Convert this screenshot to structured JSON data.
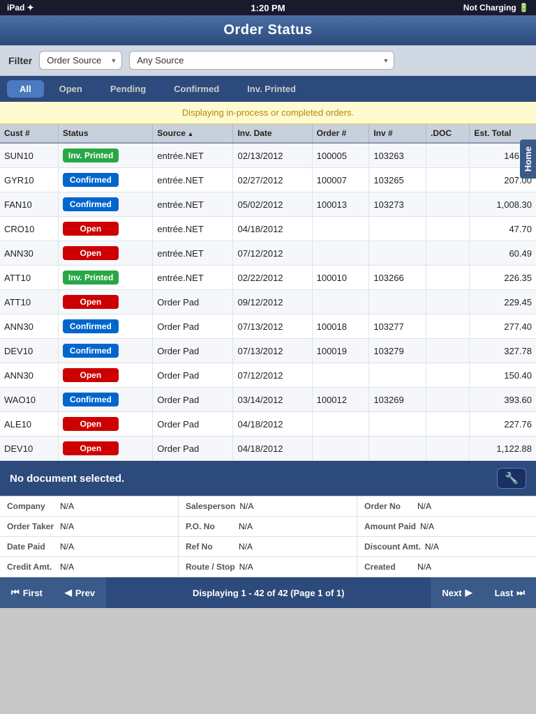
{
  "statusBar": {
    "left": "iPad ✦",
    "time": "1:20 PM",
    "right": "Not Charging 🔋"
  },
  "header": {
    "title": "Order Status"
  },
  "homeTab": "Home",
  "filter": {
    "label": "Filter",
    "sourceLabel": "Order Source",
    "sourceValue": "Any Source"
  },
  "tabs": [
    {
      "id": "all",
      "label": "All",
      "active": true
    },
    {
      "id": "open",
      "label": "Open",
      "active": false
    },
    {
      "id": "pending",
      "label": "Pending",
      "active": false
    },
    {
      "id": "confirmed",
      "label": "Confirmed",
      "active": false
    },
    {
      "id": "inv-printed",
      "label": "Inv. Printed",
      "active": false
    }
  ],
  "infoBanner": "Displaying in-process or completed orders.",
  "table": {
    "columns": [
      "Cust #",
      "Status",
      "Source",
      "Inv. Date",
      "Order #",
      "Inv #",
      ".DOC",
      "Est. Total"
    ],
    "rows": [
      {
        "cust": "SUN10",
        "status": "Inv. Printed",
        "statusType": "inv-printed",
        "source": "entrée.NET",
        "invDate": "02/13/2012",
        "order": "100005",
        "inv": "103263",
        "doc": "",
        "estTotal": "146.40"
      },
      {
        "cust": "GYR10",
        "status": "Confirmed",
        "statusType": "confirmed",
        "source": "entrée.NET",
        "invDate": "02/27/2012",
        "order": "100007",
        "inv": "103265",
        "doc": "",
        "estTotal": "207.00"
      },
      {
        "cust": "FAN10",
        "status": "Confirmed",
        "statusType": "confirmed",
        "source": "entrée.NET",
        "invDate": "05/02/2012",
        "order": "100013",
        "inv": "103273",
        "doc": "",
        "estTotal": "1,008.30"
      },
      {
        "cust": "CRO10",
        "status": "Open",
        "statusType": "open",
        "source": "entrée.NET",
        "invDate": "04/18/2012",
        "order": "",
        "inv": "",
        "doc": "",
        "estTotal": "47.70"
      },
      {
        "cust": "ANN30",
        "status": "Open",
        "statusType": "open",
        "source": "entrée.NET",
        "invDate": "07/12/2012",
        "order": "",
        "inv": "",
        "doc": "",
        "estTotal": "60.49"
      },
      {
        "cust": "ATT10",
        "status": "Inv. Printed",
        "statusType": "inv-printed",
        "source": "entrée.NET",
        "invDate": "02/22/2012",
        "order": "100010",
        "inv": "103266",
        "doc": "",
        "estTotal": "226.35"
      },
      {
        "cust": "ATT10",
        "status": "Open",
        "statusType": "open",
        "source": "Order Pad",
        "invDate": "09/12/2012",
        "order": "",
        "inv": "",
        "doc": "",
        "estTotal": "229.45"
      },
      {
        "cust": "ANN30",
        "status": "Confirmed",
        "statusType": "confirmed",
        "source": "Order Pad",
        "invDate": "07/13/2012",
        "order": "100018",
        "inv": "103277",
        "doc": "",
        "estTotal": "277.40"
      },
      {
        "cust": "DEV10",
        "status": "Confirmed",
        "statusType": "confirmed",
        "source": "Order Pad",
        "invDate": "07/13/2012",
        "order": "100019",
        "inv": "103279",
        "doc": "",
        "estTotal": "327.78"
      },
      {
        "cust": "ANN30",
        "status": "Open",
        "statusType": "open",
        "source": "Order Pad",
        "invDate": "07/12/2012",
        "order": "",
        "inv": "",
        "doc": "",
        "estTotal": "150.40"
      },
      {
        "cust": "WAO10",
        "status": "Confirmed",
        "statusType": "confirmed",
        "source": "Order Pad",
        "invDate": "03/14/2012",
        "order": "100012",
        "inv": "103269",
        "doc": "",
        "estTotal": "393.60"
      },
      {
        "cust": "ALE10",
        "status": "Open",
        "statusType": "open",
        "source": "Order Pad",
        "invDate": "04/18/2012",
        "order": "",
        "inv": "",
        "doc": "",
        "estTotal": "227.76"
      },
      {
        "cust": "DEV10",
        "status": "Open",
        "statusType": "open",
        "source": "Order Pad",
        "invDate": "04/18/2012",
        "order": "",
        "inv": "",
        "doc": "",
        "estTotal": "1,122.88"
      }
    ]
  },
  "docSection": {
    "noDocText": "No document selected.",
    "toolIcon": "🔧",
    "details": [
      {
        "label": "Company",
        "value": "N/A",
        "col": 1
      },
      {
        "label": "Salesperson",
        "value": "N/A",
        "col": 2
      },
      {
        "label": "Order No",
        "value": "N/A",
        "col": 3
      },
      {
        "label": "Order Taker",
        "value": "N/A",
        "col": 1
      },
      {
        "label": "P.O. No",
        "value": "N/A",
        "col": 2
      },
      {
        "label": "Amount Paid",
        "value": "N/A",
        "col": 3
      },
      {
        "label": "Date Paid",
        "value": "N/A",
        "col": 1
      },
      {
        "label": "Ref No",
        "value": "N/A",
        "col": 2
      },
      {
        "label": "Discount Amt.",
        "value": "N/A",
        "col": 3
      },
      {
        "label": "Credit Amt.",
        "value": "N/A",
        "col": 1
      },
      {
        "label": "Route / Stop",
        "value": "N/A",
        "col": 2
      },
      {
        "label": "Created",
        "value": "N/A",
        "col": 3
      }
    ]
  },
  "pagination": {
    "firstLabel": "First",
    "prevLabel": "Prev",
    "nextLabel": "Next",
    "lastLabel": "Last",
    "info": "Displaying 1 - 42 of 42 (Page 1 of 1)"
  }
}
